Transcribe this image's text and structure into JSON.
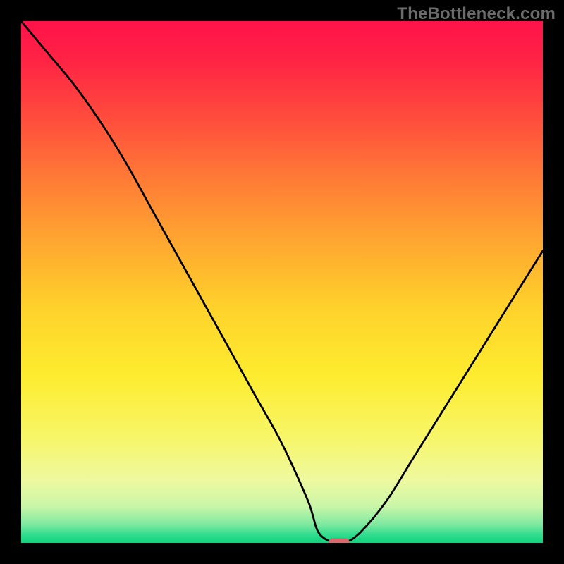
{
  "watermark": "TheBottleneck.com",
  "chart_data": {
    "type": "line",
    "title": "",
    "xlabel": "",
    "ylabel": "",
    "xlim": [
      0,
      100
    ],
    "ylim": [
      0,
      100
    ],
    "x": [
      0,
      5,
      10,
      15,
      20,
      25,
      30,
      35,
      40,
      45,
      50,
      55,
      57,
      60,
      62,
      65,
      70,
      75,
      80,
      85,
      90,
      95,
      100
    ],
    "y": [
      100,
      94,
      88,
      81,
      73,
      64,
      55,
      46,
      37,
      28,
      19,
      8,
      2,
      0,
      0,
      2,
      8,
      16,
      24,
      32,
      40,
      48,
      56
    ],
    "min_marker": {
      "x": 61,
      "y": 0,
      "color": "#d86a6f"
    },
    "gradient_stops": [
      {
        "offset": 0.0,
        "color": "#ff124a"
      },
      {
        "offset": 0.08,
        "color": "#ff2544"
      },
      {
        "offset": 0.18,
        "color": "#ff4a3d"
      },
      {
        "offset": 0.3,
        "color": "#ff7a36"
      },
      {
        "offset": 0.42,
        "color": "#ffa630"
      },
      {
        "offset": 0.55,
        "color": "#ffd22b"
      },
      {
        "offset": 0.68,
        "color": "#fdec2f"
      },
      {
        "offset": 0.8,
        "color": "#f7f66a"
      },
      {
        "offset": 0.88,
        "color": "#eef9a0"
      },
      {
        "offset": 0.93,
        "color": "#c9f6a8"
      },
      {
        "offset": 0.965,
        "color": "#7ce9a0"
      },
      {
        "offset": 0.985,
        "color": "#2fdc8e"
      },
      {
        "offset": 1.0,
        "color": "#0fd47e"
      }
    ]
  },
  "plot_geometry": {
    "inner_left": 30,
    "inner_top": 30,
    "inner_width": 740,
    "inner_height": 740
  }
}
